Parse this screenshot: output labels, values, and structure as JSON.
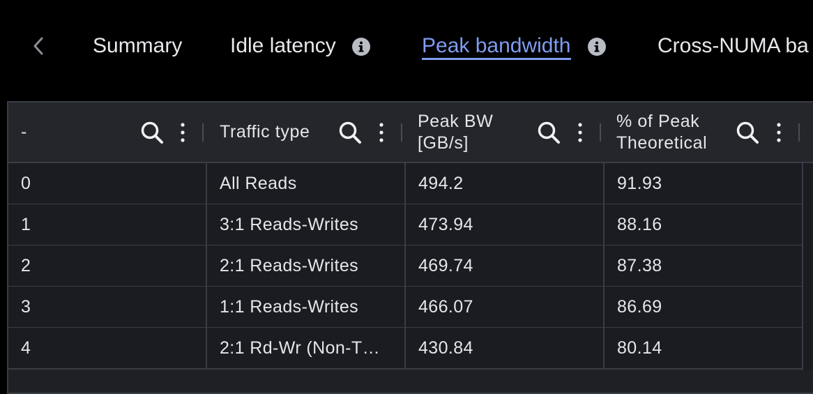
{
  "tabs": {
    "items": [
      {
        "label": "Summary",
        "active": false,
        "has_info": false
      },
      {
        "label": "Idle latency",
        "active": false,
        "has_info": true
      },
      {
        "label": "Peak bandwidth",
        "active": true,
        "has_info": true
      },
      {
        "label": "Cross-NUMA ba",
        "active": false,
        "has_info": false
      }
    ],
    "back_icon": "chevron-left-icon",
    "info_icon": "info-icon",
    "accent_color": "#7f9cf0"
  },
  "table": {
    "columns": [
      {
        "label": "-",
        "icons": [
          "search-icon",
          "kebab-menu-icon"
        ]
      },
      {
        "label": "Traffic type",
        "icons": [
          "search-icon",
          "kebab-menu-icon"
        ]
      },
      {
        "label": "Peak BW [GB/s]",
        "icons": [
          "search-icon",
          "kebab-menu-icon"
        ]
      },
      {
        "label": "% of Peak Theoretical",
        "icons": [
          "search-icon",
          "kebab-menu-icon"
        ]
      }
    ],
    "header_lines": {
      "col3_line1": "Peak BW",
      "col3_line2": "[GB/s]",
      "col4_line1": "% of Peak",
      "col4_line2": "Theoretical"
    },
    "rows": [
      {
        "index": "0",
        "traffic_type": "All Reads",
        "peak_bw": "494.2",
        "pct_peak": "91.93"
      },
      {
        "index": "1",
        "traffic_type": "3:1 Reads-Writes",
        "peak_bw": "473.94",
        "pct_peak": "88.16"
      },
      {
        "index": "2",
        "traffic_type": "2:1 Reads-Writes",
        "peak_bw": "469.74",
        "pct_peak": "87.38"
      },
      {
        "index": "3",
        "traffic_type": "1:1 Reads-Writes",
        "peak_bw": "466.07",
        "pct_peak": "86.69"
      },
      {
        "index": "4",
        "traffic_type": "2:1 Rd-Wr (Non-T…",
        "peak_bw": "430.84",
        "pct_peak": "80.14"
      }
    ]
  }
}
